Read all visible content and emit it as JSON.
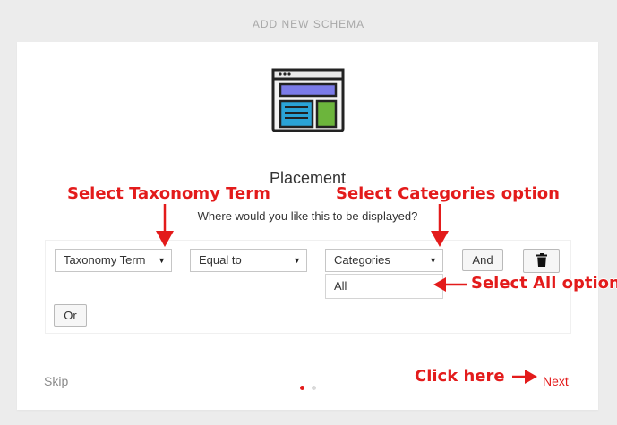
{
  "page_title": "ADD NEW SCHEMA",
  "card": {
    "heading": "Placement",
    "subheading": "Where would you like this to be displayed?",
    "illustration_icon": "browser-layout-icon"
  },
  "rules": {
    "select_1": "Taxonomy Term",
    "select_2": "Equal to",
    "select_3": "Categories",
    "dropdown_value": "All",
    "and_label": "And",
    "or_label": "Or",
    "delete_icon": "trash-icon"
  },
  "footer": {
    "skip_label": "Skip",
    "next_label": "Next",
    "pagination": {
      "total": 2,
      "active": 1
    }
  },
  "annotations": {
    "select_taxonomy": "Select Taxonomy Term",
    "select_categories": "Select Categories option",
    "select_all": "Select All option",
    "click_here": "Click here"
  },
  "colors": {
    "annotation": "#e31b1b",
    "next_link": "#e31b1b",
    "dot_active": "#e31b1b",
    "dot_inactive": "#d9d9d9"
  }
}
